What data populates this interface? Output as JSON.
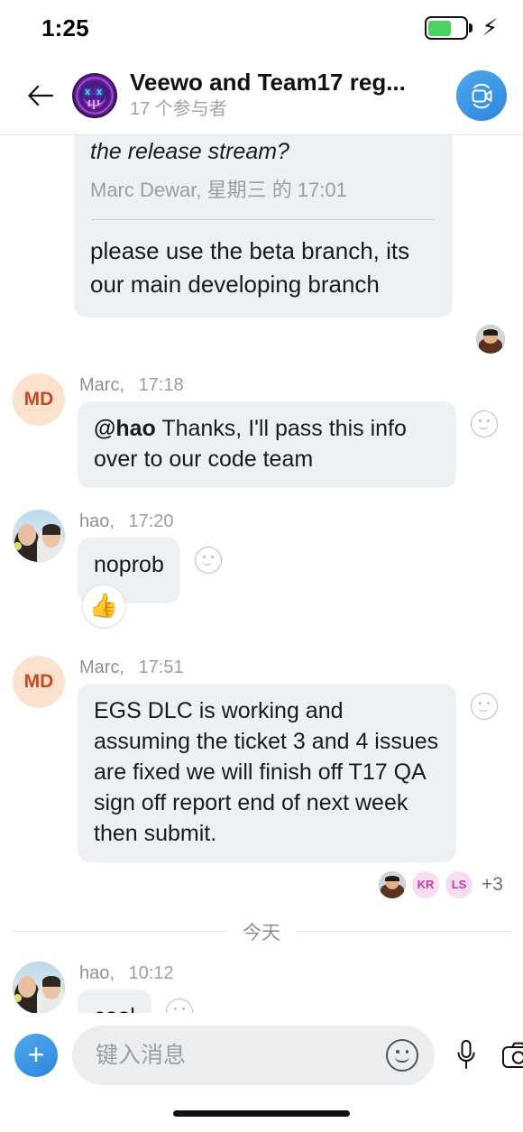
{
  "status_bar": {
    "time": "1:25",
    "battery_level_pct": 62,
    "battery_icon": "battery-icon",
    "charging_icon": "lightning-bolt-icon"
  },
  "header": {
    "back_icon": "arrow-left-icon",
    "avatar_icon": "group-avatar-neon-smiley",
    "title": "Veewo and Team17 reg...",
    "subtitle": "17 个参与者",
    "call_button_icon": "video-camera-icon"
  },
  "thread": {
    "quoted_message": {
      "quote_text": "the release stream?",
      "quote_attribution": "Marc Dewar, 星期三 的 17:01",
      "body": "please use the beta branch, its our main developing branch",
      "receipt_avatar": "photo-avatar-marc"
    },
    "messages": [
      {
        "avatar_type": "initials",
        "avatar_initials": "MD",
        "sender": "Marc,",
        "time": "17:18",
        "mention": "@hao",
        "text": "  Thanks, I'll pass this info over to our code team",
        "react_icon": "add-reaction-smiley-icon"
      },
      {
        "avatar_type": "photo",
        "avatar_initials": "",
        "sender": "hao,",
        "time": "17:20",
        "mention": "",
        "text": "noprob",
        "react_icon": "add-reaction-smiley-icon",
        "reaction": "👍"
      },
      {
        "avatar_type": "initials",
        "avatar_initials": "MD",
        "sender": "Marc,",
        "time": "17:51",
        "mention": "",
        "text": "EGS DLC is working and assuming the ticket 3 and 4 issues are fixed we will finish off T17 QA sign off report end of next week then submit.",
        "react_icon": "add-reaction-smiley-icon"
      }
    ],
    "read_receipts": {
      "avatars": [
        {
          "kind": "photo",
          "label": ""
        },
        {
          "kind": "initials",
          "label": "KR"
        },
        {
          "kind": "initials",
          "label": "LS"
        }
      ],
      "more_count": "+3"
    },
    "date_divider": "今天",
    "today_message": {
      "avatar_type": "photo",
      "sender": "hao,",
      "time": "10:12",
      "text": "cool",
      "react_icon": "add-reaction-smiley-icon",
      "receipt_avatar": "photo-avatar-hao"
    }
  },
  "composer": {
    "add_icon": "plus-icon",
    "input_value": "",
    "input_placeholder": "键入消息",
    "emoji_icon": "smiley-icon",
    "mic_icon": "microphone-icon",
    "camera_icon": "camera-icon"
  },
  "colors": {
    "accent_blue": "#2f86e0",
    "bubble_bg": "#EEF1F4",
    "battery_green": "#4CD263",
    "initials_avatar_bg": "#FBE2CF",
    "initials_avatar_fg": "#C34A28",
    "receipt_pink_bg": "#F6DDEF",
    "receipt_pink_fg": "#C23BAE"
  }
}
